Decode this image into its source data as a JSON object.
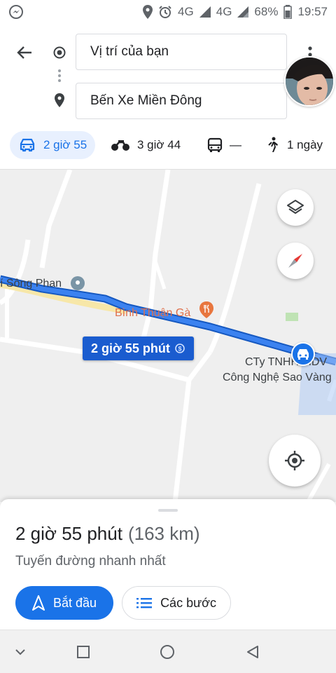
{
  "status_bar": {
    "network_1": "4G",
    "network_2": "4G",
    "battery": "68%",
    "time": "19:57",
    "icons": [
      "messenger-icon",
      "location-icon",
      "alarm-icon",
      "signal-icon",
      "battery-icon"
    ]
  },
  "header": {
    "origin": "Vị trí của bạn",
    "destination": "Bến Xe Miền Đông"
  },
  "modes": [
    {
      "icon": "car-icon",
      "label": "2 giờ 55",
      "active": true
    },
    {
      "icon": "motorbike-icon",
      "label": "3 giờ 44",
      "active": false
    },
    {
      "icon": "bus-icon",
      "label": "—",
      "active": false
    },
    {
      "icon": "walk-icon",
      "label": "1 ngày",
      "active": false
    }
  ],
  "map": {
    "labels": {
      "place_1": "í Sông Phan",
      "place_2": "Bình Thuận Gà",
      "place_3": "CTy TNHH MDV",
      "place_4": "Công Nghệ Sao Vàng"
    },
    "route_badge": "2 giờ 55 phút",
    "colors": {
      "route": "#1a73e8",
      "route_border": "#1558c0",
      "background": "#efefef",
      "road": "#ffffff",
      "alt_road": "#f7e7a8"
    }
  },
  "sheet": {
    "duration": "2 giờ 55 phút",
    "distance": "(163 km)",
    "subtitle": "Tuyến đường nhanh nhất",
    "start_label": "Bắt đầu",
    "steps_label": "Các bước"
  },
  "navbar": {
    "icons": [
      "chevron-down-icon",
      "recents-icon",
      "home-icon",
      "back-icon"
    ]
  }
}
